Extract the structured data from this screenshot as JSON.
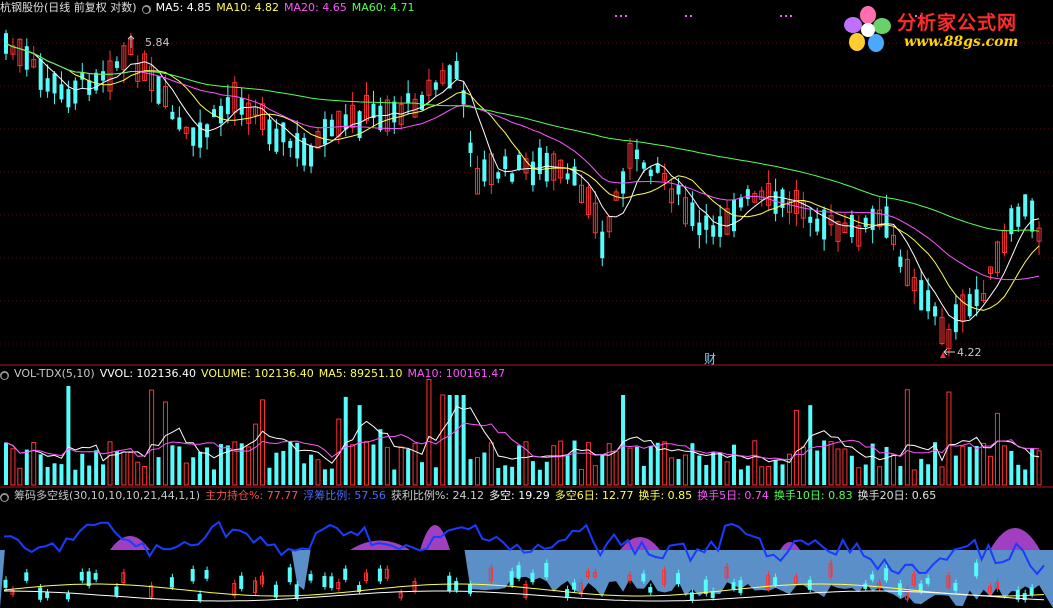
{
  "header_main": {
    "title": "杭钢股份(日线 前复权 对数)",
    "ma5": "MA5: 4.85",
    "ma10": "MA10: 4.82",
    "ma20": "MA20: 4.65",
    "ma60": "MA60: 4.71"
  },
  "header_vol": {
    "title": "VOL-TDX(5,10)",
    "vvol": "VVOL: 102136.40",
    "volume": "VOLUME: 102136.40",
    "ma5": "MA5: 89251.10",
    "ma10": "MA10: 100161.47"
  },
  "header_ind": {
    "title": "筹码多空线(30,10,10,10,21,44,1,1)",
    "main_hold": "主力持仓%: 77.77",
    "float_ratio": "浮筹比例: 57.56",
    "profit_ratio": "获利比例%: 24.12",
    "longshort": "多空: 19.29",
    "longshort6": "多空6日: 12.77",
    "turnover": "换手: 0.85",
    "turnover5": "换手5日: 0.74",
    "turnover10": "换手10日: 0.83",
    "turnover20": "换手20日: 0.65"
  },
  "logo": {
    "name": "分析家公式网",
    "url": "www.88gs.com"
  },
  "annotations": {
    "high": "5.84",
    "low": "4.22",
    "finance_marker": "财"
  },
  "colors": {
    "up": "#ff3232",
    "down": "#54fcfc",
    "ma5": "#ffffff",
    "ma10": "#ffff54",
    "ma20": "#ff54ff",
    "ma60": "#54ff54",
    "float": "#5a8fc8",
    "profit": "#a040c0",
    "blueline": "#1a3cff"
  },
  "chart_data": {
    "type": "candlestick",
    "y_scale": "log",
    "price_extremes": {
      "high": 5.84,
      "low": 4.22
    },
    "latest": {
      "ma5": 4.85,
      "ma10": 4.82,
      "ma20": 4.65,
      "ma60": 4.71,
      "vvol": 102136.4,
      "volume": 102136.4,
      "vol_ma5": 89251.1,
      "vol_ma10": 100161.47
    }
  }
}
